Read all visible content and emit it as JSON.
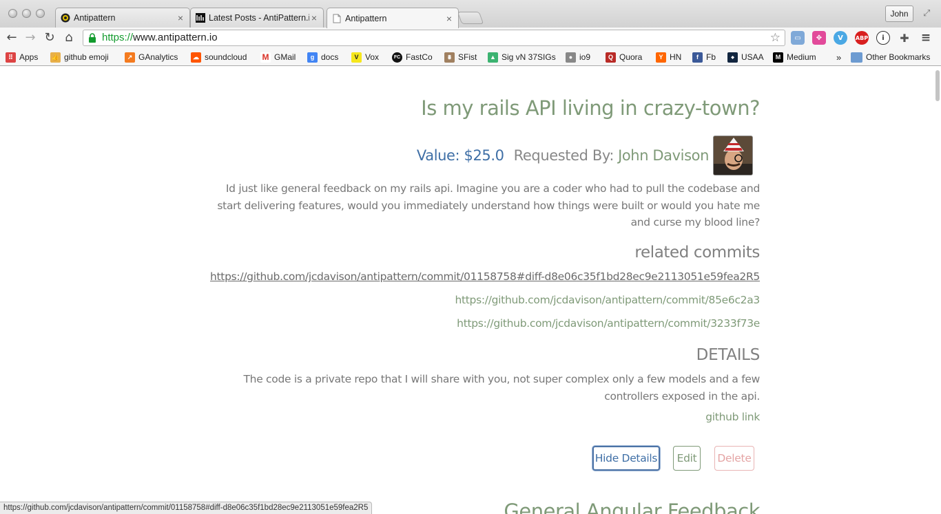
{
  "browser": {
    "tabs": [
      {
        "title": "Antipattern",
        "icon": "antipattern-favicon-icon"
      },
      {
        "title": "Latest Posts - AntiPattern.i",
        "icon": "antipattern-blog-favicon-icon"
      },
      {
        "title": "Antipattern",
        "icon": "document-icon"
      }
    ],
    "profile_name": "John",
    "url_scheme": "https://",
    "url_rest": "www.antipattern.io",
    "extensions": [
      "cast-icon",
      "colorzilla-icon",
      "vimeo-icon",
      "adblock-icon",
      "info-icon",
      "puzzle-icon",
      "menu-icon"
    ],
    "bookmarks": [
      {
        "label": "Apps",
        "icon": "apps-grid-icon",
        "color": "#d44"
      },
      {
        "label": "github emoji",
        "icon": "thumbs-up-icon",
        "color": "#e8b04a"
      },
      {
        "label": "GAnalytics",
        "icon": "analytics-icon",
        "color": "#f47b20"
      },
      {
        "label": "soundcloud",
        "icon": "soundcloud-icon",
        "color": "#ff5500"
      },
      {
        "label": "GMail",
        "icon": "gmail-icon",
        "color": "#d93025"
      },
      {
        "label": "docs",
        "icon": "google-icon",
        "color": "#4285f4"
      },
      {
        "label": "Vox",
        "icon": "vox-icon",
        "color": "#f6e71c"
      },
      {
        "label": "FastCo",
        "icon": "fastco-icon",
        "color": "#111111"
      },
      {
        "label": "SFist",
        "icon": "sfist-icon",
        "color": "#a08060"
      },
      {
        "label": "Sig vN 37SIGs",
        "icon": "signal-icon",
        "color": "#3cb371"
      },
      {
        "label": "io9",
        "icon": "io9-icon",
        "color": "#888888"
      },
      {
        "label": "Quora",
        "icon": "quora-icon",
        "color": "#b92b27"
      },
      {
        "label": "HN",
        "icon": "hacker-news-icon",
        "color": "#ff6600"
      },
      {
        "label": "Fb",
        "icon": "facebook-icon",
        "color": "#3b5998"
      },
      {
        "label": "USAA",
        "icon": "usaa-icon",
        "color": "#12263f"
      },
      {
        "label": "Medium",
        "icon": "medium-icon",
        "color": "#000000"
      }
    ],
    "overflow_chevron": "»",
    "other_bookmarks": "Other Bookmarks",
    "status_url": "https://github.com/jcdavison/antipattern/commit/01158758#diff-d8e06c35f1bd28ec9e2113051e59fea2R5"
  },
  "post": {
    "title": "Is my rails API living in crazy-town?",
    "value": "Value: $25.0",
    "requested_by_label": "Requested By:",
    "requester": "John Davison",
    "description": "Id just like general feedback on my rails api. Imagine you are a coder who had to pull the codebase and start delivering features, would you immediately understand how things were built or would you hate me and curse my blood line?",
    "related_heading": "related commits",
    "commits": [
      "https://github.com/jcdavison/antipattern/commit/01158758#diff-d8e06c35f1bd28ec9e2113051e59fea2R5",
      "https://github.com/jcdavison/antipattern/commit/85e6c2a3",
      "https://github.com/jcdavison/antipattern/commit/3233f73e"
    ],
    "details_heading": "DETAILS",
    "details_text": "The code is a private repo that I will share with you, not super complex only a few models and a few controllers exposed in the api.",
    "github_link": "github link",
    "buttons": {
      "hide": "Hide Details",
      "edit": "Edit",
      "delete": "Delete"
    }
  },
  "next_post": {
    "title": "General Angular Feedback"
  },
  "colors": {
    "accent_green": "#7f9a78",
    "value_blue": "#3f6fa6",
    "delete_red": "#e4a4a4"
  }
}
